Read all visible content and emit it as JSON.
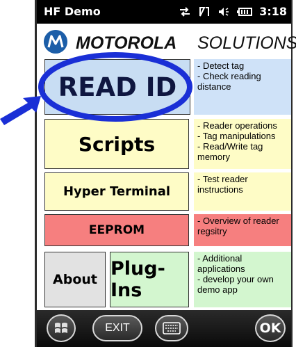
{
  "statusbar": {
    "title": "HF Demo",
    "clock": "3:18"
  },
  "logo": {
    "brand_bold": "MOTOROLA",
    "brand_light": "SOLUTIONS"
  },
  "buttons": {
    "read_id": "READ ID",
    "scripts": "Scripts",
    "hyper_terminal": "Hyper Terminal",
    "eeprom": "EEPROM",
    "about": "About",
    "plugins": "Plug-Ins"
  },
  "descriptions": {
    "read_id": [
      "- Detect tag",
      "- Check reading",
      "distance"
    ],
    "scripts": [
      "- Reader operations",
      "- Tag manipulations",
      "- Read/Write tag",
      "memory"
    ],
    "hyper_terminal": [
      "- Test reader",
      "instructions"
    ],
    "eeprom": [
      "- Overview of reader",
      "regsitry"
    ],
    "plugins": [
      "- Additional",
      "applications",
      "- develop your own",
      "demo app"
    ]
  },
  "softkeys": {
    "exit": "EXIT",
    "ok": "OK"
  },
  "colors": {
    "read_id_bg": "#c8ddf3",
    "scripts_bg": "#fefcc6",
    "eeprom_bg": "#f67f7f",
    "about_bg": "#e2e2e2",
    "plugins_bg": "#d3f6cf",
    "annotation": "#1a2fd6"
  },
  "icons": [
    "connectivity-icon",
    "signal-icon",
    "volume-icon",
    "battery-icon",
    "windows-start-icon",
    "keyboard-icon",
    "motorola-logo-icon"
  ]
}
